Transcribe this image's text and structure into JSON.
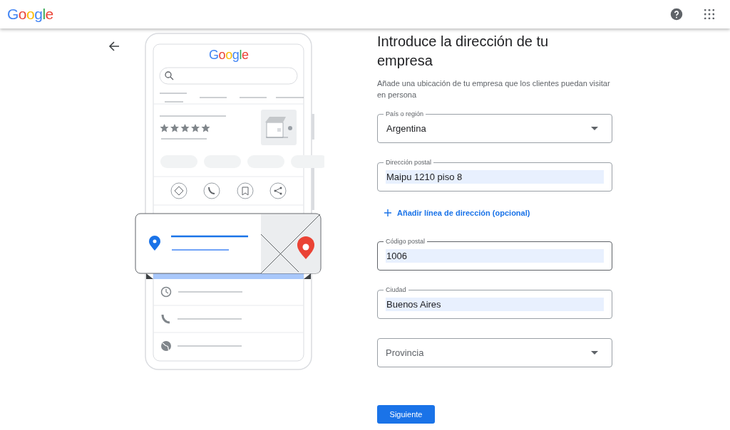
{
  "header": {
    "logo": "Google"
  },
  "form": {
    "title": "Introduce la dirección de tu empresa",
    "subtitle": "Añade una ubicación de tu empresa que los clientes puedan visitar en persona",
    "fields": [
      {
        "kind": "select",
        "label": "País o región",
        "value": "Argentina",
        "focused": false
      },
      {
        "kind": "text",
        "label": "Dirección postal",
        "value": "Maipu 1210 piso 8",
        "autofilled": true,
        "focused": false
      },
      {
        "kind": "link",
        "label": "Añadir línea de dirección (opcional)"
      },
      {
        "kind": "text",
        "label": "Código postal",
        "value": "1006",
        "autofilled": true,
        "focused": true
      },
      {
        "kind": "text",
        "label": "Ciudad",
        "value": "Buenos Aires",
        "autofilled": true,
        "focused": false
      },
      {
        "kind": "select",
        "placeholder": "Provincia",
        "focused": false
      }
    ],
    "next_button": "Siguiente"
  },
  "illustration": {
    "logo": "Google"
  }
}
